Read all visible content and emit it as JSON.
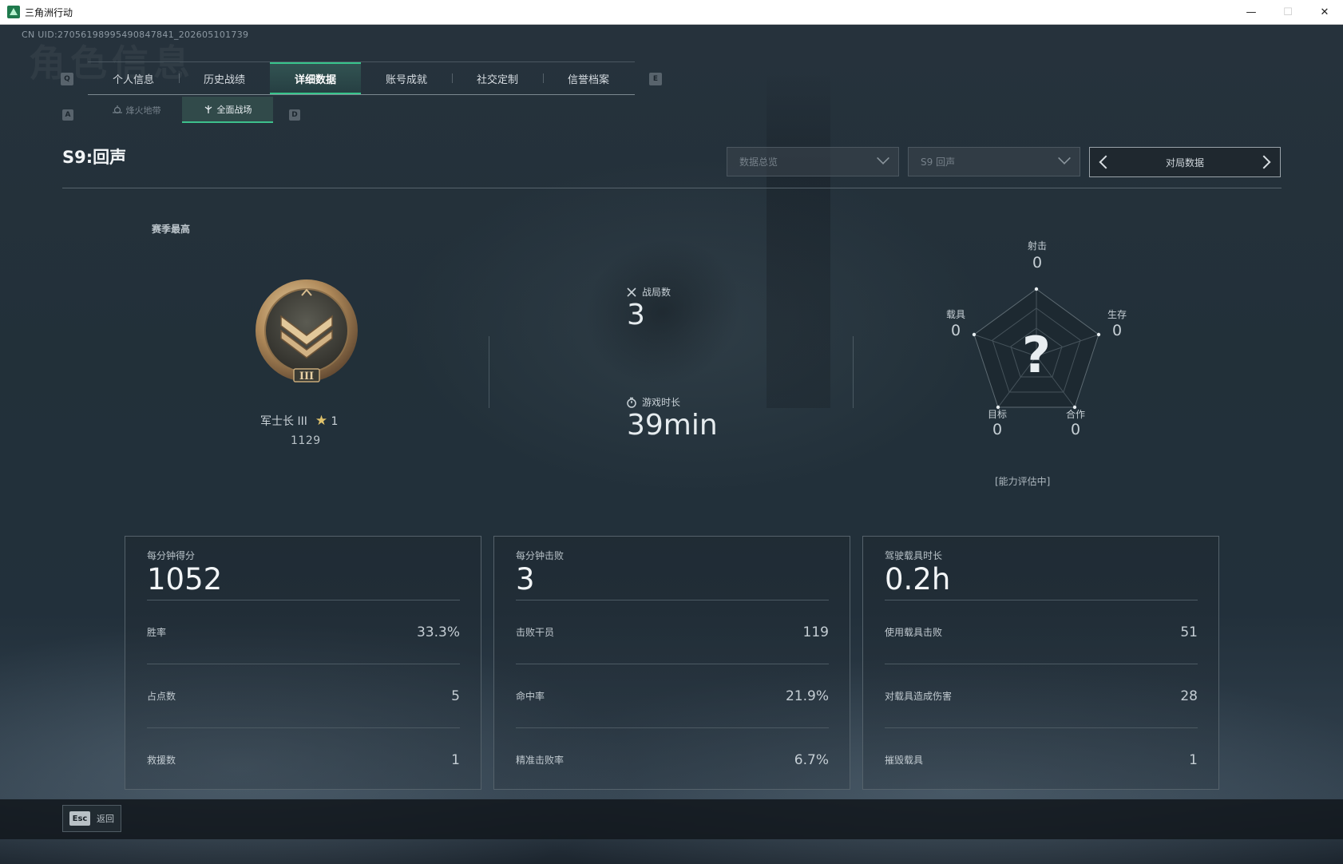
{
  "window": {
    "title": "三角洲行动",
    "minimize": "—",
    "maximize": "☐",
    "close": "✕"
  },
  "uid": "CN UID:270561989954908478​41_202605101739",
  "watermark": "角色信息",
  "nav": {
    "prev_key": "Q",
    "next_key": "E",
    "tabs": [
      {
        "label": "个人信息"
      },
      {
        "label": "历史战绩"
      },
      {
        "label": "详细数据",
        "active": true
      },
      {
        "label": "账号成就"
      },
      {
        "label": "社交定制"
      },
      {
        "label": "信誉档案"
      }
    ]
  },
  "subnav": {
    "prev_key": "A",
    "next_key": "D",
    "tabs": [
      {
        "label": "烽火地带"
      },
      {
        "label": "全面战场",
        "active": true
      }
    ]
  },
  "header": {
    "season_title": "S9:回声",
    "dropdown_overview": "数据总览",
    "dropdown_season": "S9 回声",
    "pager_label": "对局数据"
  },
  "rank": {
    "section_label": "赛季最高",
    "badge_numeral": "III",
    "name": "军士长 III",
    "stars": "1",
    "score": "1129"
  },
  "summary": {
    "matches_label": "战局数",
    "matches_value": "3",
    "playtime_label": "游戏时长",
    "playtime_value": "39min"
  },
  "radar": {
    "center_mark": "?",
    "status": "[能力评估中]",
    "axes": [
      {
        "label": "射击",
        "value": "0"
      },
      {
        "label": "生存",
        "value": "0"
      },
      {
        "label": "合作",
        "value": "0"
      },
      {
        "label": "目标",
        "value": "0"
      },
      {
        "label": "载具",
        "value": "0"
      }
    ]
  },
  "panels": [
    {
      "head_label": "每分钟得分",
      "head_value": "1052",
      "rows": [
        {
          "label": "胜率",
          "value": "33.3%"
        },
        {
          "label": "占点数",
          "value": "5"
        },
        {
          "label": "救援数",
          "value": "1"
        }
      ]
    },
    {
      "head_label": "每分钟击败",
      "head_value": "3",
      "rows": [
        {
          "label": "击败干员",
          "value": "119"
        },
        {
          "label": "命中率",
          "value": "21.9%"
        },
        {
          "label": "精准击败率",
          "value": "6.7%"
        }
      ]
    },
    {
      "head_label": "驾驶载具时长",
      "head_value": "0.2h",
      "rows": [
        {
          "label": "使用载具击败",
          "value": "51"
        },
        {
          "label": "对载具造成伤害",
          "value": "28"
        },
        {
          "label": "摧毁载具",
          "value": "1"
        }
      ]
    }
  ],
  "footer": {
    "esc_key": "Esc",
    "back_label": "返回"
  }
}
